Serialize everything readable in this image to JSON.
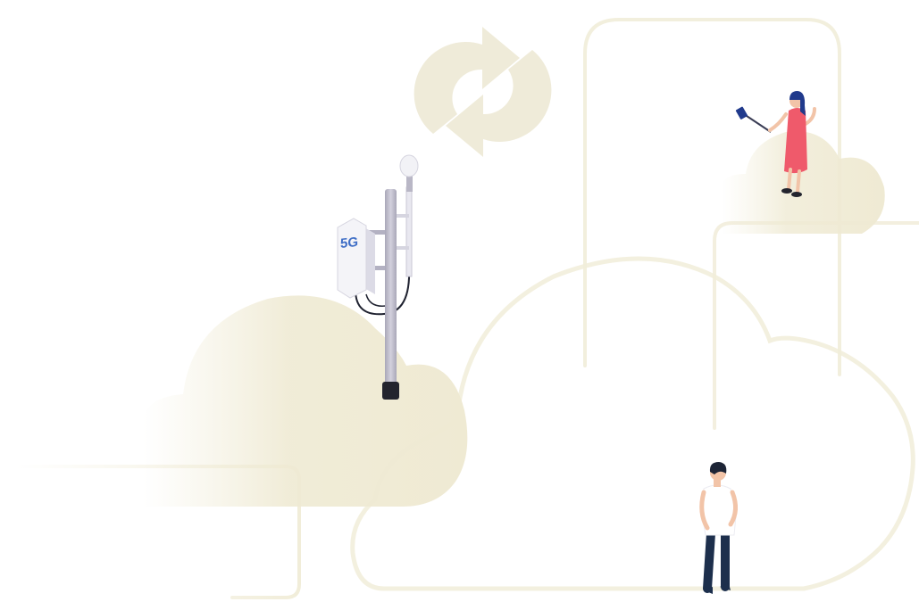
{
  "illustration": {
    "antenna_label": "5G"
  },
  "colors": {
    "background": "#ffffff",
    "cloud_fill": "#efead3",
    "cloud_outline": "#f1edd9",
    "sync_icon": "#efebd9",
    "pole": "#c9c7d4",
    "pole_shade": "#a9a7b8",
    "antenna_box": "#f4f4f8",
    "antenna_side": "#dcdbe6",
    "label": "#3f6ec6",
    "dress": "#ef5a6b",
    "hair": "#203a8c",
    "skin": "#f2c4a8",
    "man_shirt": "#ffffff",
    "man_pants": "#1d2f4c",
    "man_hair": "#1d2436"
  },
  "icons": {
    "sync": "sync-icon",
    "cell_tower": "cell-tower-icon"
  }
}
